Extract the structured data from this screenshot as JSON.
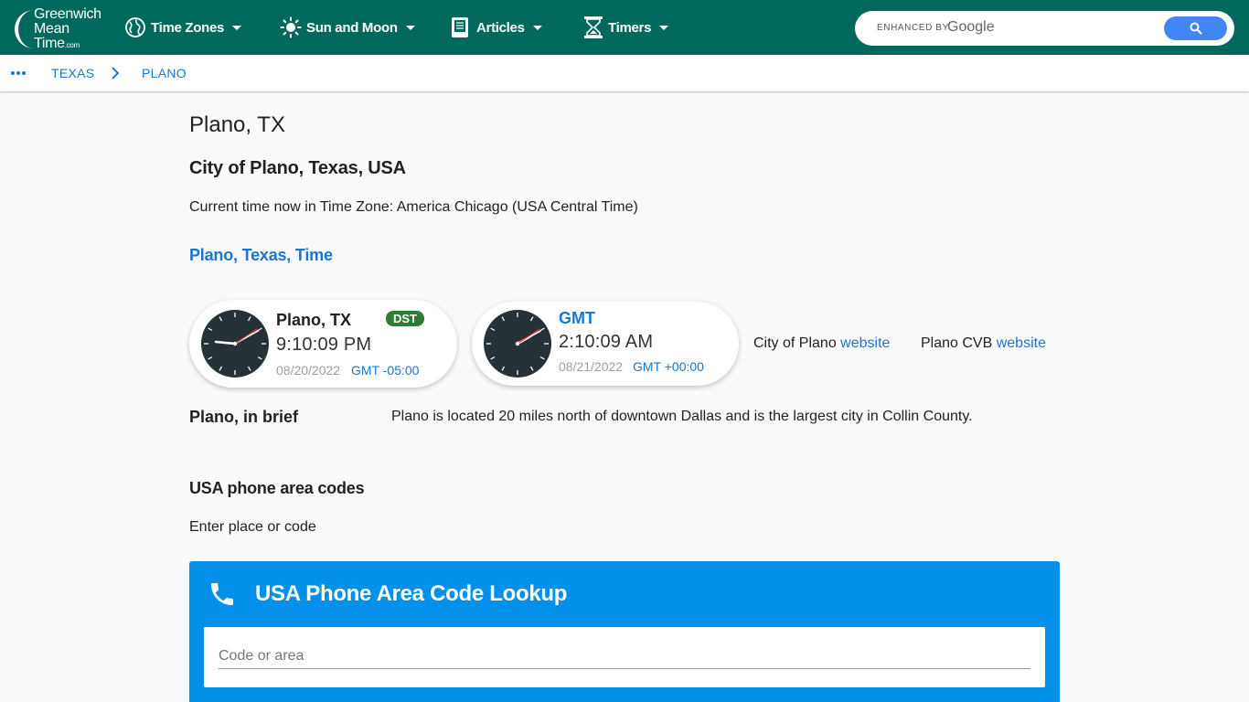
{
  "header": {
    "logo": {
      "line1": "Greenwich",
      "line2": "Mean",
      "line3": "Time",
      "suffix": ".com"
    },
    "nav": [
      {
        "label": "Time Zones",
        "icon": "globe-icon"
      },
      {
        "label": "Sun and Moon",
        "icon": "sun-icon"
      },
      {
        "label": "Articles",
        "icon": "book-icon"
      },
      {
        "label": "Timers",
        "icon": "hourglass-icon"
      }
    ],
    "search": {
      "enhanced_by": "ENHANCED BY",
      "brand": "Google",
      "placeholder": ""
    }
  },
  "breadcrumb": {
    "items": [
      "TEXAS",
      "PLANO"
    ]
  },
  "main": {
    "title": "Plano, TX",
    "subtitle": "City of Plano, Texas, USA",
    "timezone_text": "Current time now in Time Zone: America Chicago (USA Central Time)",
    "time_link": "Plano, Texas, Time",
    "clocks": [
      {
        "name": "Plano, TX",
        "badge": "DST",
        "time": "9:10:09 PM",
        "date": "08/20/2022",
        "offset": "GMT -05:00"
      },
      {
        "name": "GMT",
        "time": "2:10:09 AM",
        "date": "08/21/2022",
        "offset": "GMT +00:00"
      }
    ],
    "links": [
      {
        "prefix": "City of Plano",
        "link": "website"
      },
      {
        "prefix": "Plano CVB",
        "link": "website"
      }
    ],
    "brief": {
      "heading": "Plano, in brief",
      "text": "Plano is located 20 miles north of downtown Dallas and is the largest city in Collin County."
    },
    "area_codes": {
      "heading": "USA phone area codes",
      "prompt": "Enter place or code",
      "lookup_title": "USA Phone Area Code Lookup",
      "input_placeholder": "Code or area"
    }
  },
  "colors": {
    "header": "#00695c",
    "link": "#1976d2",
    "lookup": "#0290ea",
    "dst_badge": "#2e7d32"
  }
}
